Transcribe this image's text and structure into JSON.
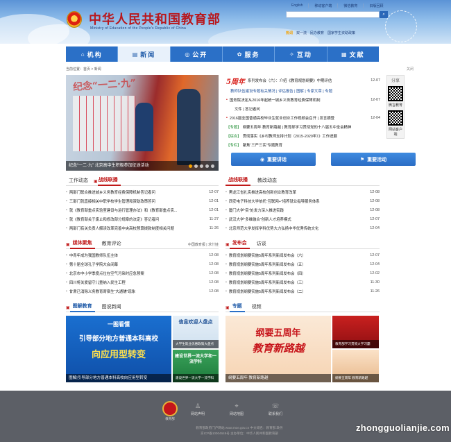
{
  "header": {
    "title": "中华人民共和国教育部",
    "subtitle": "Ministry of Education of the People's Republic of China",
    "toplinks": [
      "English",
      "移动客户端",
      "微信教育",
      "旧版回顾"
    ],
    "search_btn": "⌕",
    "hotwords_label": "热词",
    "hotwords": [
      "双一流",
      "民办教育",
      "国家学生资助政策"
    ]
  },
  "nav": [
    {
      "icon": "⌂",
      "label": "机构"
    },
    {
      "icon": "▤",
      "label": "新闻"
    },
    {
      "icon": "◎",
      "label": "公开"
    },
    {
      "icon": "✿",
      "label": "服务"
    },
    {
      "icon": "✧",
      "label": "互动"
    },
    {
      "icon": "▦",
      "label": "文献"
    }
  ],
  "breadcrumb": "当前位置：首页 > 新闻",
  "top_right_label": "关闭",
  "carousel": {
    "banner_text": "纪念“一二·九”",
    "caption": "纪念“一二·九”  北京高中生积极参加征途活动"
  },
  "headlines": {
    "lead": {
      "logo": "5周年",
      "text": "系列发布会（六）：介绍《教育规划纲要》中期评估",
      "date": "12-07"
    },
    "lead_links": "教师队伍建设专题有关情况 | 评估报告 | 图解 | 专家文章 | 专题",
    "items": [
      {
        "tag": "",
        "text": "国务院决定从2016年起统一城乡义务教育经费保障机制",
        "date": "12-07"
      },
      {
        "tag": "",
        "text": "文件 | 答记者问",
        "date": ""
      },
      {
        "tag": "",
        "text": "2016届全国普通高校毕业生就业创业工作视频会召开 | 发言摘登",
        "date": "12-04"
      },
      {
        "tag": "【专题】",
        "text": "纲要五周年 教育新路越 | 教育部学习贯彻党的十八届五中全会精神",
        "date": ""
      },
      {
        "tag": "【综合】",
        "text": "贯彻落实《乡村教师支持计划（2015-2020年）》工作进展",
        "date": ""
      },
      {
        "tag": "【专栏】",
        "text": "聚焦“三严三实”专题教育",
        "date": ""
      }
    ],
    "btn_left": "重要讲话",
    "btn_right": "重要活动"
  },
  "share": {
    "label": "分享",
    "cap1": "微言教育",
    "cap2": "网站客户端"
  },
  "work": {
    "tabs": [
      "工作动态",
      "战线联播"
    ],
    "more": "",
    "items": [
      {
        "text": "两部门联合推进城乡义务教育经费保障机制答记者问",
        "date": "12-07"
      },
      {
        "text": "三部门就直接相关中职学校学生管理和资助政策答问",
        "date": "12-01"
      },
      {
        "text": "就《教育部重点实验室建设与运行管理办法》和《教育部重点实...",
        "date": "12-01"
      },
      {
        "text": "就《教育部关于废止和修改部分规章的决定》答记者问",
        "date": "11-27"
      },
      {
        "text": "两部门有关负责人解读改革完善中央高校预算拨款制度相关问题",
        "date": "11-26"
      }
    ]
  },
  "front": {
    "tabs": [
      "战线联播",
      "教改动态"
    ],
    "items": [
      {
        "text": "黑龙江省扎实推进高校创新创业教育改革",
        "date": "12-08"
      },
      {
        "text": "西安电子科技大学依托“互联网+”培养就业指导服务体系",
        "date": "12-08"
      },
      {
        "text": "厦门大学“实”处发力深入推进实践",
        "date": "12-08"
      },
      {
        "text": "武汉大学“多维融合”创新人才培养模式",
        "date": "12-07"
      },
      {
        "text": "北京师范大学发挥学科优势大力弘扬中华优秀传统文化",
        "date": "12-04"
      }
    ]
  },
  "media": {
    "tabs": [
      "媒体聚焦",
      "教育评论"
    ],
    "more": "中国教育报 | 求什娃",
    "items": [
      {
        "text": "中青年成为我国教师队伍主体",
        "date": "12-08"
      },
      {
        "text": "第十届全球孔子学院大会闭幕",
        "date": "12-08"
      },
      {
        "text": "北京市中小学季度点位在空气污染时应急预案",
        "date": "12-08"
      },
      {
        "text": "四川将关爱留守儿童纳入民生工程",
        "date": "12-08"
      },
      {
        "text": "甘肃已消除义务教育寄宿生“大通铺”现象",
        "date": "12-08"
      }
    ]
  },
  "press": {
    "tabs": [
      "发布会",
      "访谈"
    ],
    "items": [
      {
        "text": "教育规划纲要实施5周年系列新闻发布会（六）",
        "date": "12-07"
      },
      {
        "text": "教育规划纲要实施5周年系列新闻发布会（五）",
        "date": "12-04"
      },
      {
        "text": "教育规划纲要实施5周年系列新闻发布会（四）",
        "date": "12-02"
      },
      {
        "text": "教育规划纲要实施5周年系列新闻发布会（三）",
        "date": "11-30"
      },
      {
        "text": "教育规划纲要实施5周年系列新闻发布会（二）",
        "date": "11-26"
      }
    ]
  },
  "infographic": {
    "tabs": [
      "图解教育",
      "图说新闻"
    ],
    "main_line1": "一图看懂",
    "main_line2": "引导部分地方普通本科高校",
    "main_line3": "向应用型转变",
    "caption": "图解|引导部分地方普通本科高校向应用型转变",
    "side_top": "信息欢迎人盘点",
    "side_top_cap": "大学生就业优惠政策大盘点",
    "side_bottom": "建设世界一流大学和一流学科",
    "side_bottom_cap": "建设世界一流大学一流学科"
  },
  "special": {
    "tabs": [
      "专题",
      "视频"
    ],
    "main_line1": "纲要五周年",
    "main_line2": "教育新路越",
    "caption": "纲要五周年 教育新路越",
    "side_top_cap": "教育部学习贯彻大学习霸",
    "side_bottom_cap": "纲要五周年 教育新路越"
  },
  "footer": {
    "logo_label": "教育部",
    "links": [
      {
        "icon": "♙",
        "label": "网站声明"
      },
      {
        "icon": "⌖",
        "label": "网站地图"
      },
      {
        "icon": "☏",
        "label": "联系我们"
      }
    ],
    "info_line1": "教育部政府门户网站  www.moe.gov.cn    中文域名：教育部.政务",
    "info_line2": "京ICP备10004649号     主办单位：中华人民共和国教育部"
  },
  "watermark": "zhongguolianjie.com",
  "colors": {
    "nav_blue": "#2b70c7",
    "brand_red": "#b8181e",
    "footer": "#5c5f66"
  }
}
